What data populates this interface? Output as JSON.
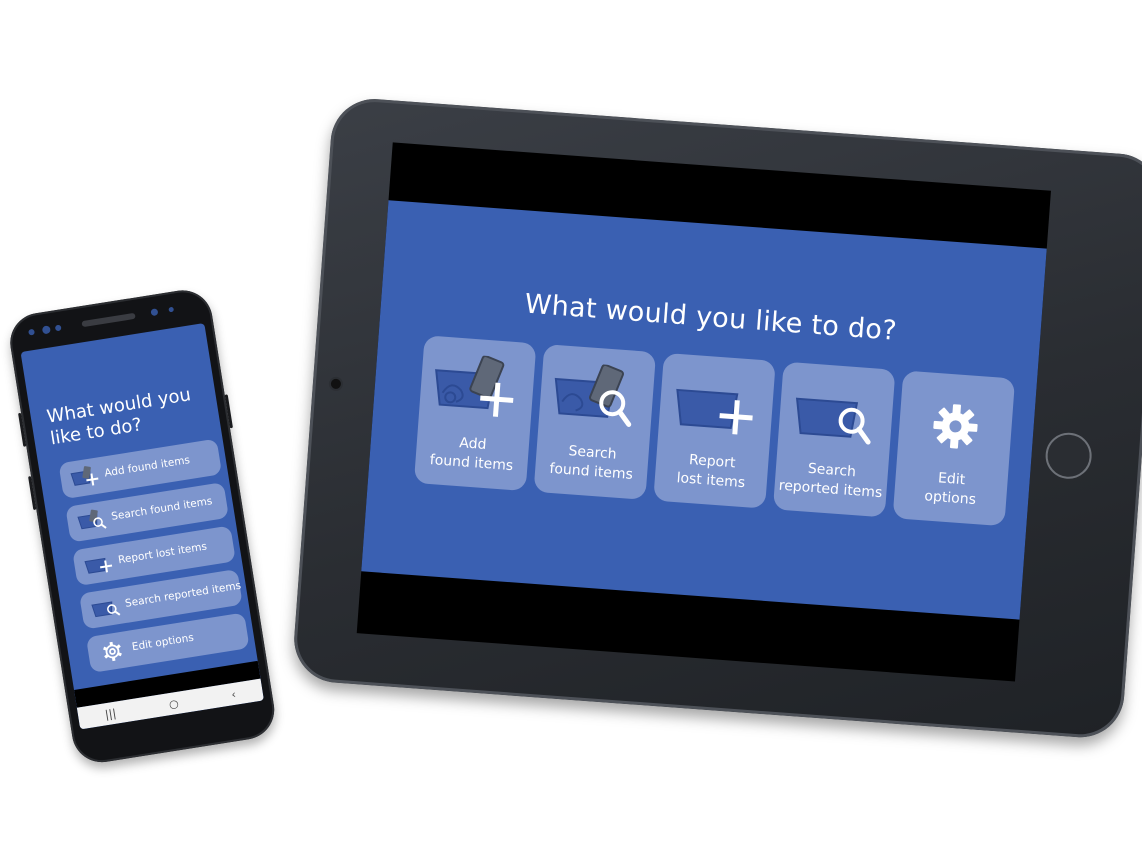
{
  "tablet": {
    "title": "What would you like to do?",
    "tiles": [
      {
        "label": "Add\nfound items",
        "icon": "add-found-items-icon"
      },
      {
        "label": "Search\nfound items",
        "icon": "search-found-items-icon"
      },
      {
        "label": "Report\nlost items",
        "icon": "report-lost-items-icon"
      },
      {
        "label": "Search\nreported items",
        "icon": "search-reported-items-icon"
      },
      {
        "label": "Edit\noptions",
        "icon": "gear-icon"
      }
    ]
  },
  "phone": {
    "title": "What would you like to do?",
    "items": [
      {
        "label": "Add found items",
        "icon": "add-found-items-icon"
      },
      {
        "label": "Search found items",
        "icon": "search-found-items-icon"
      },
      {
        "label": "Report lost items",
        "icon": "report-lost-items-icon"
      },
      {
        "label": "Search reported items",
        "icon": "search-reported-items-icon"
      },
      {
        "label": "Edit options",
        "icon": "gear-icon"
      }
    ],
    "nav": {
      "recents": "|||",
      "home": "○",
      "back": "‹"
    }
  },
  "colors": {
    "app_background": "#3a60b2",
    "tile_background": "#7d95cd",
    "text": "#ffffff",
    "device_frame": "#2a2d32"
  }
}
